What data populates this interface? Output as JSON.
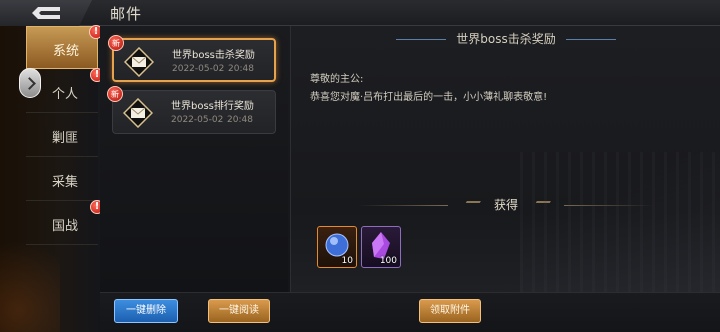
{
  "header": {
    "title": "邮件"
  },
  "sidebar": {
    "items": [
      {
        "label": "系统",
        "alert": "!"
      },
      {
        "label": "个人",
        "alert": "!"
      },
      {
        "label": "剿匪",
        "alert": ""
      },
      {
        "label": "采集",
        "alert": ""
      },
      {
        "label": "国战",
        "alert": "!"
      }
    ]
  },
  "mails": [
    {
      "badge": "新",
      "subject": "世界boss击杀奖励",
      "date": "2022-05-02",
      "time": "20:48"
    },
    {
      "badge": "新",
      "subject": "世界boss排行奖励",
      "date": "2022-05-02",
      "time": "20:48"
    }
  ],
  "detail": {
    "title": "世界boss击杀奖励",
    "salutation": "尊敬的主公:",
    "body": "恭喜您对魔·吕布打出最后的一击，小小薄礼聊表敬意!",
    "obtain_label": "获得",
    "rewards": [
      {
        "icon": "blue-orb-icon",
        "qty": "10"
      },
      {
        "icon": "purple-crystal-icon",
        "qty": "100"
      }
    ]
  },
  "footer": {
    "delete_all": "一键删除",
    "read_all": "一键阅读",
    "claim": "领取附件"
  },
  "colors": {
    "active_tab": "#c79a55",
    "selected_border": "#e7a24d",
    "alert_red": "#c0160c",
    "blue_button": "#1c5fb0"
  }
}
